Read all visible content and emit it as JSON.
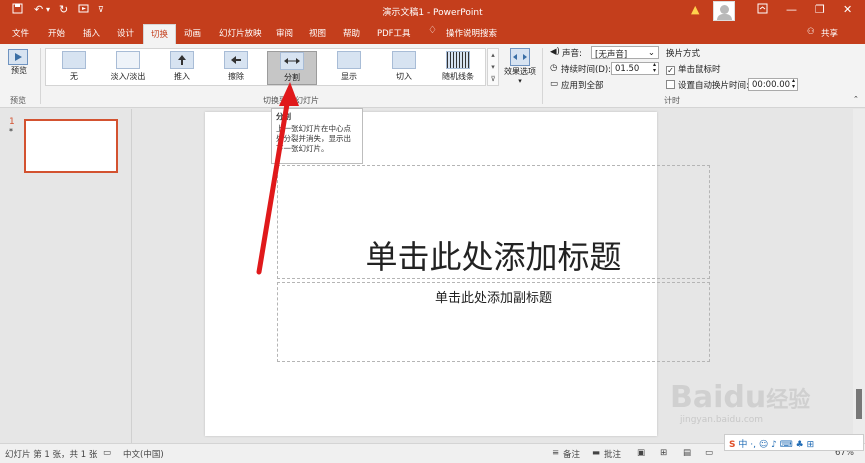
{
  "app": {
    "title": "演示文稿1  -  PowerPoint",
    "share_label": "共享",
    "warning_icon": "warning-icon",
    "colors": {
      "accent": "#c43e1c",
      "ribbon_bg": "#f3f3f3",
      "selected_gallery": "#c6c6c6",
      "arrow": "#e0191b"
    }
  },
  "quick_access": {
    "save_icon": "save-icon",
    "undo_icon": "undo-icon",
    "redo_icon": "redo-icon",
    "present_icon": "slideshow-icon",
    "customize_icon": "customize-icon"
  },
  "window_controls": {
    "ribbon_options": "ribbon-display-icon",
    "minimize": "minimize-icon",
    "restore": "restore-icon",
    "close": "close-icon"
  },
  "tabs": [
    {
      "label": "文件"
    },
    {
      "label": "开始"
    },
    {
      "label": "插入"
    },
    {
      "label": "设计"
    },
    {
      "label": "切换"
    },
    {
      "label": "动画"
    },
    {
      "label": "幻灯片放映"
    },
    {
      "label": "审阅"
    },
    {
      "label": "视图"
    },
    {
      "label": "帮助"
    },
    {
      "label": "PDF工具"
    }
  ],
  "tell_me": "操作说明搜索",
  "ribbon": {
    "preview_label": "预览",
    "preview_group": "预览",
    "transitions_group": "切换到此幻灯片",
    "transitions": [
      {
        "label": "无"
      },
      {
        "label": "淡入/淡出"
      },
      {
        "label": "推入"
      },
      {
        "label": "擦除"
      },
      {
        "label": "分割"
      },
      {
        "label": "显示"
      },
      {
        "label": "切入"
      },
      {
        "label": "随机线条"
      }
    ],
    "effect_options": "效果选项",
    "sound_label": "声音:",
    "sound_value": "[无声音]",
    "duration_label": "持续时间(D):",
    "duration_value": "01.50",
    "apply_all": "应用到全部",
    "advance_title": "换片方式",
    "on_click": "单击鼠标时",
    "on_click_checked": true,
    "after_label": "设置自动换片时间:",
    "after_value": "00:00.00",
    "after_checked": false,
    "timing_group": "计时"
  },
  "tooltip": {
    "title": "分割",
    "body": "上一张幻灯片在中心点处分裂并消失，显示出下一张幻灯片。"
  },
  "thumbnail": {
    "number": "1",
    "star": "*"
  },
  "slide": {
    "title_placeholder": "单击此处添加标题",
    "subtitle_placeholder": "单击此处添加副标题"
  },
  "statusbar": {
    "slide_info": "幻灯片 第 1 张，共 1 张",
    "language": "中文(中国)",
    "notes": "备注",
    "comments": "批注",
    "zoom": "67%"
  },
  "watermark": {
    "brand": "Baidu",
    "suffix": "经验",
    "url": "jingyan.baidu.com"
  },
  "ime": {
    "label": "中"
  }
}
